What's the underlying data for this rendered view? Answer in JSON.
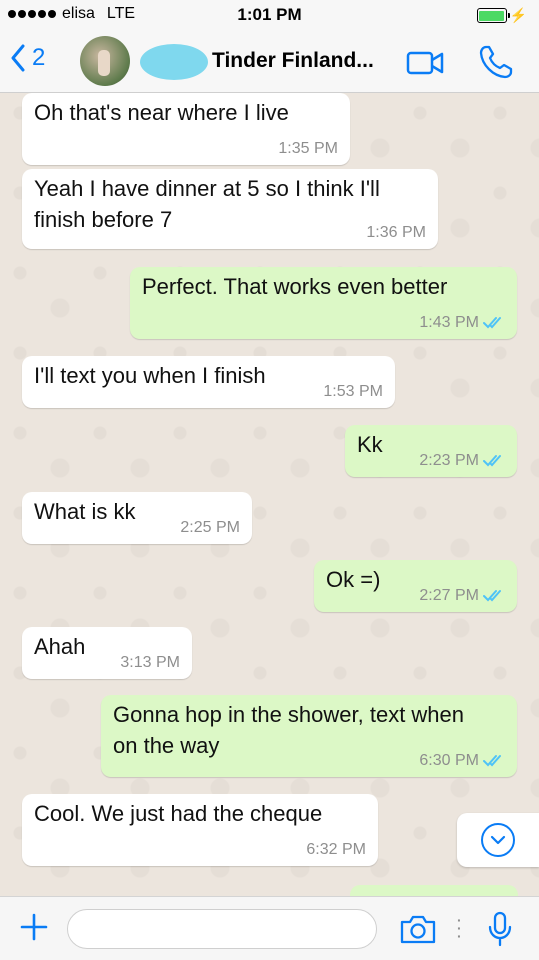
{
  "status": {
    "carrier": "elisa",
    "network": "LTE",
    "time": "1:01 PM"
  },
  "header": {
    "back_count": "2",
    "contact_name": "Tinder Finland..."
  },
  "messages": [
    {
      "dir": "in",
      "text": "Oh that's near where I live",
      "time": "1:35 PM"
    },
    {
      "dir": "in",
      "text": "Yeah I have dinner at 5 so I think I'll\nfinish before 7",
      "time": "1:36 PM"
    },
    {
      "dir": "out",
      "text": "Perfect. That works even better",
      "time": "1:43 PM",
      "read": true
    },
    {
      "dir": "in",
      "text": "I'll text you when I finish",
      "time": "1:53 PM"
    },
    {
      "dir": "out",
      "text": "Kk",
      "time": "2:23 PM",
      "read": true
    },
    {
      "dir": "in",
      "text": "What is kk",
      "time": "2:25 PM"
    },
    {
      "dir": "out",
      "text": "Ok =)",
      "time": "2:27 PM",
      "read": true
    },
    {
      "dir": "in",
      "text": "Ahah",
      "time": "3:13 PM"
    },
    {
      "dir": "out",
      "text": "Gonna hop in the shower, text when\non the way",
      "time": "6:30 PM",
      "read": true
    },
    {
      "dir": "in",
      "text": "Cool. We just had the cheque",
      "time": "6:32 PM"
    }
  ],
  "input": {
    "value": "",
    "placeholder": ""
  },
  "colors": {
    "accent": "#0a7cf5",
    "outgoing_bubble": "#dcf8c6",
    "incoming_bubble": "#ffffff",
    "chat_bg": "#ece5dd",
    "read_ticks": "#4fc3f7"
  },
  "icons": [
    "back-chevron-icon",
    "video-call-icon",
    "phone-icon",
    "plus-icon",
    "camera-icon",
    "microphone-icon",
    "scroll-down-icon",
    "read-ticks-icon"
  ]
}
